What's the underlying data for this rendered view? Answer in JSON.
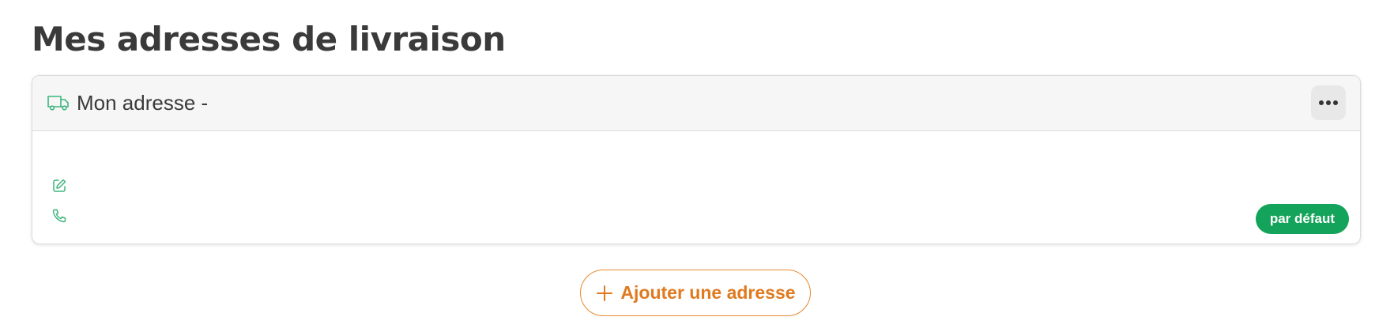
{
  "page": {
    "title": "Mes adresses de livraison"
  },
  "address_card": {
    "title": "Mon adresse -",
    "header_icon": "truck-icon",
    "more_icon": "more-horizontal-icon",
    "detail_icons": [
      "edit-icon",
      "phone-icon"
    ],
    "badge": "par défaut"
  },
  "actions": {
    "add_address_label": "Ajouter une adresse",
    "add_icon": "plus-icon"
  },
  "colors": {
    "accent_green": "#14a35a",
    "icon_green": "#3fb57c",
    "accent_orange": "#e07a1f",
    "text_dark": "#3a3a3a"
  }
}
